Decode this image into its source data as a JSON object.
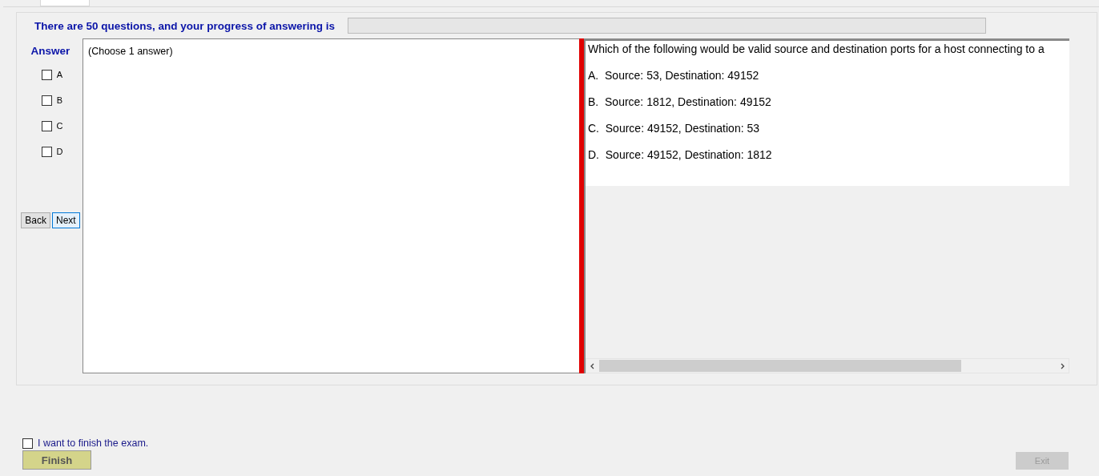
{
  "header": {
    "text": "There are 50 questions, and your progress of answering is",
    "progress": {
      "level": 0
    }
  },
  "answer_panel": {
    "title": "Answer",
    "options": [
      {
        "label": "A",
        "checked": false
      },
      {
        "label": "B",
        "checked": false
      },
      {
        "label": "C",
        "checked": false
      },
      {
        "label": "D",
        "checked": false
      }
    ],
    "buttons": [
      {
        "label": "Back",
        "selected": false
      },
      {
        "label": "Next",
        "selected": true
      }
    ]
  },
  "answer_note": "(Choose 1 answer)",
  "question": {
    "text": "Which of the following would be valid source and destination ports for a host connecting to a",
    "choices": [
      "A.  Source: 53, Destination: 49152",
      "B.  Source: 1812, Destination: 49152",
      "C.  Source: 49152, Destination: 53",
      "D.  Source: 49152, Destination: 1812"
    ]
  },
  "finish": {
    "label": "I want to finish the exam.",
    "checked": false,
    "button": "Finish"
  },
  "exit": {
    "label": "Exit",
    "disabled": true
  }
}
